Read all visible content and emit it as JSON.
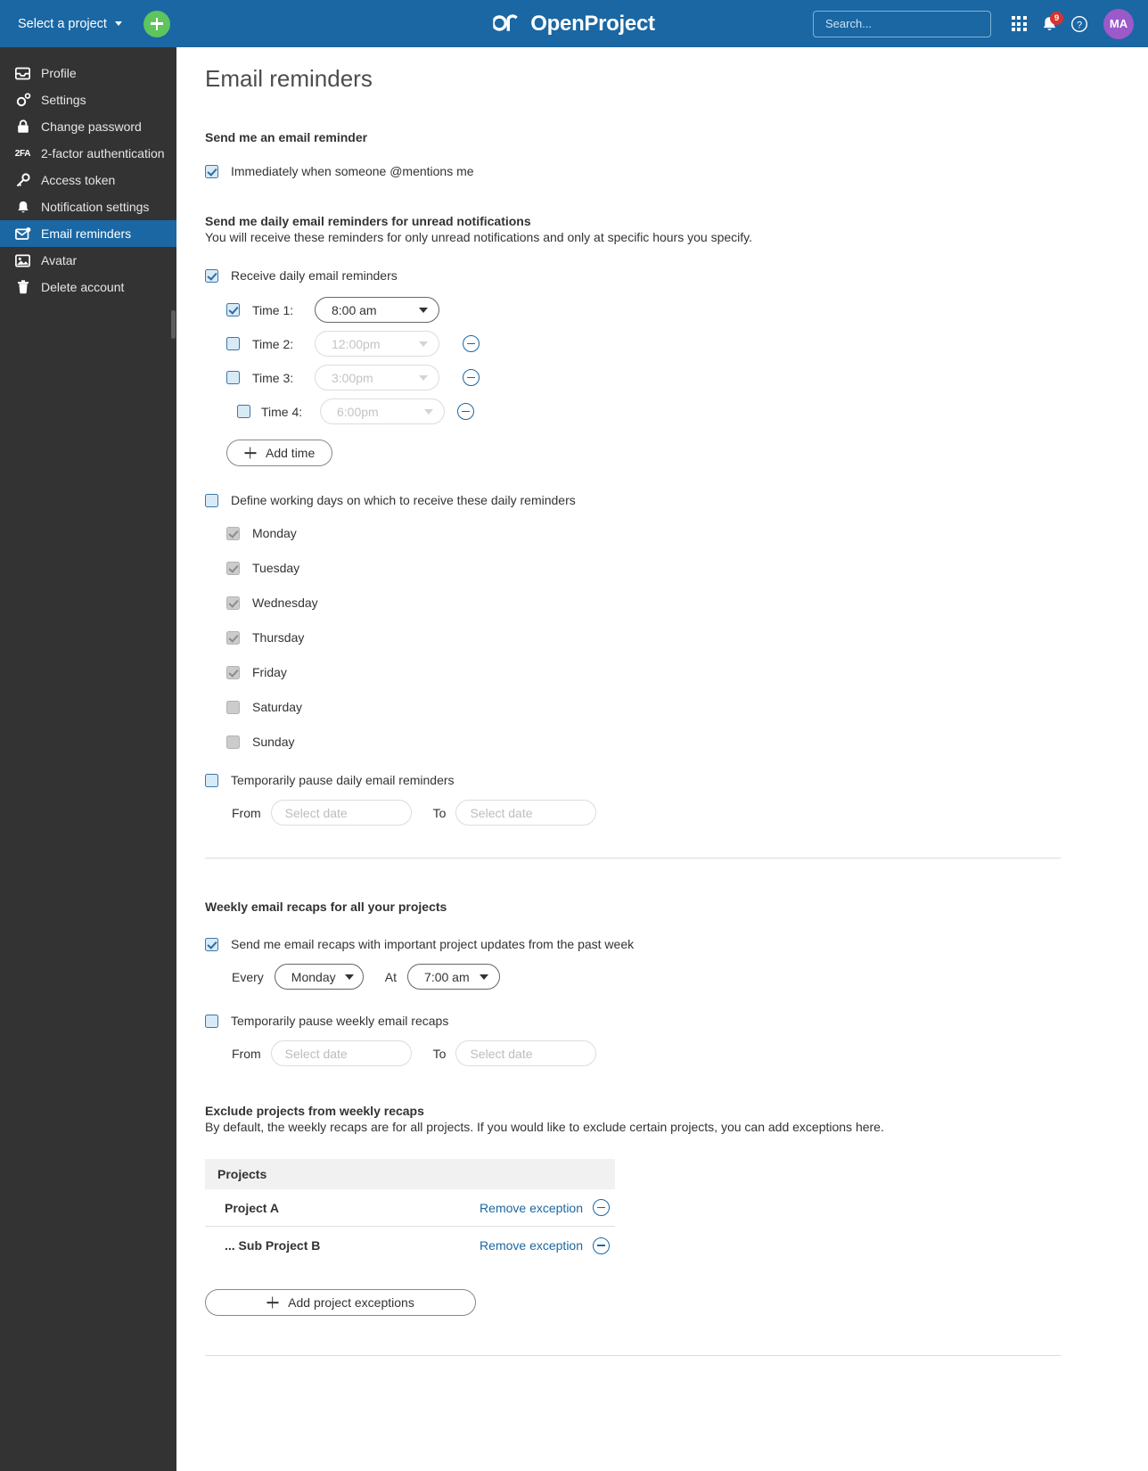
{
  "topbar": {
    "project_selector_label": "Select a project",
    "add_project_tooltip": "+",
    "brand_name": "OpenProject",
    "search_placeholder": "Search...",
    "notification_count": "9",
    "avatar_initials": "MA"
  },
  "sidebar": {
    "items": [
      {
        "label": "Profile",
        "icon": "profile-icon",
        "active": false
      },
      {
        "label": "Settings",
        "icon": "gear-icon",
        "active": false
      },
      {
        "label": "Change password",
        "icon": "lock-icon",
        "active": false
      },
      {
        "label": "2-factor authentication",
        "icon": "2fa-icon",
        "active": false
      },
      {
        "label": "Access token",
        "icon": "key-icon",
        "active": false
      },
      {
        "label": "Notification settings",
        "icon": "bell-icon",
        "active": false
      },
      {
        "label": "Email reminders",
        "icon": "mail-alert-icon",
        "active": true
      },
      {
        "label": "Avatar",
        "icon": "image-icon",
        "active": false
      },
      {
        "label": "Delete account",
        "icon": "trash-icon",
        "active": false
      }
    ]
  },
  "page": {
    "title": "Email reminders"
  },
  "mention_section": {
    "heading": "Send me an email reminder",
    "checkbox_label": "Immediately when someone @mentions me",
    "checked": true
  },
  "daily_section": {
    "heading": "Send me daily email reminders for unread notifications",
    "description": "You will receive these reminders for only unread notifications and only at specific hours you specify.",
    "enable_label": "Receive daily email reminders",
    "enabled": true,
    "times": [
      {
        "label": "Time 1:",
        "value": "8:00 am",
        "checked": true,
        "disabled": false,
        "removable": false
      },
      {
        "label": "Time 2:",
        "value": "12:00pm",
        "checked": false,
        "disabled": true,
        "removable": true
      },
      {
        "label": "Time 3:",
        "value": "3:00pm",
        "checked": false,
        "disabled": true,
        "removable": true
      },
      {
        "label": "Time 4:",
        "value": "6:00pm",
        "checked": false,
        "disabled": true,
        "removable": true
      }
    ],
    "add_time_label": "Add time",
    "working_days_label": "Define working days on which to receive these daily reminders",
    "working_days_enabled": false,
    "days": [
      {
        "label": "Monday",
        "checked": true,
        "disabled": true
      },
      {
        "label": "Tuesday",
        "checked": true,
        "disabled": true
      },
      {
        "label": "Wednesday",
        "checked": true,
        "disabled": true
      },
      {
        "label": "Thursday",
        "checked": true,
        "disabled": true
      },
      {
        "label": "Friday",
        "checked": true,
        "disabled": true
      },
      {
        "label": "Saturday",
        "checked": false,
        "disabled": true
      },
      {
        "label": "Sunday",
        "checked": false,
        "disabled": true
      }
    ],
    "pause_label": "Temporarily pause daily email reminders",
    "pause_checked": false,
    "from_label": "From",
    "to_label": "To",
    "from_placeholder": "Select date",
    "to_placeholder": "Select date"
  },
  "weekly_section": {
    "heading": "Weekly email recaps for all your projects",
    "enable_label": "Send me email recaps with important project updates from the past week",
    "enabled": true,
    "every_label": "Every",
    "every_value": "Monday",
    "at_label": "At",
    "at_value": "7:00 am",
    "pause_label": "Temporarily pause weekly email recaps",
    "pause_checked": false,
    "from_label": "From",
    "to_label": "To",
    "from_placeholder": "Select date",
    "to_placeholder": "Select date"
  },
  "exclude_section": {
    "heading": "Exclude projects from weekly recaps",
    "description": "By default, the weekly recaps are for all projects. If you would like to exclude certain projects, you can add exceptions here.",
    "table_header": "Projects",
    "rows": [
      {
        "name": "Project A",
        "action_label": "Remove exception"
      },
      {
        "name": "... Sub Project B",
        "action_label": "Remove exception"
      }
    ],
    "add_button_label": "Add project exceptions"
  },
  "colors": {
    "brand_blue": "#1a67a3",
    "sidebar_dark": "#333333",
    "accent_green": "#5ec45e",
    "badge_red": "#d9332e",
    "avatar_purple": "#9b59c9",
    "link_blue": "#1a67a3"
  }
}
